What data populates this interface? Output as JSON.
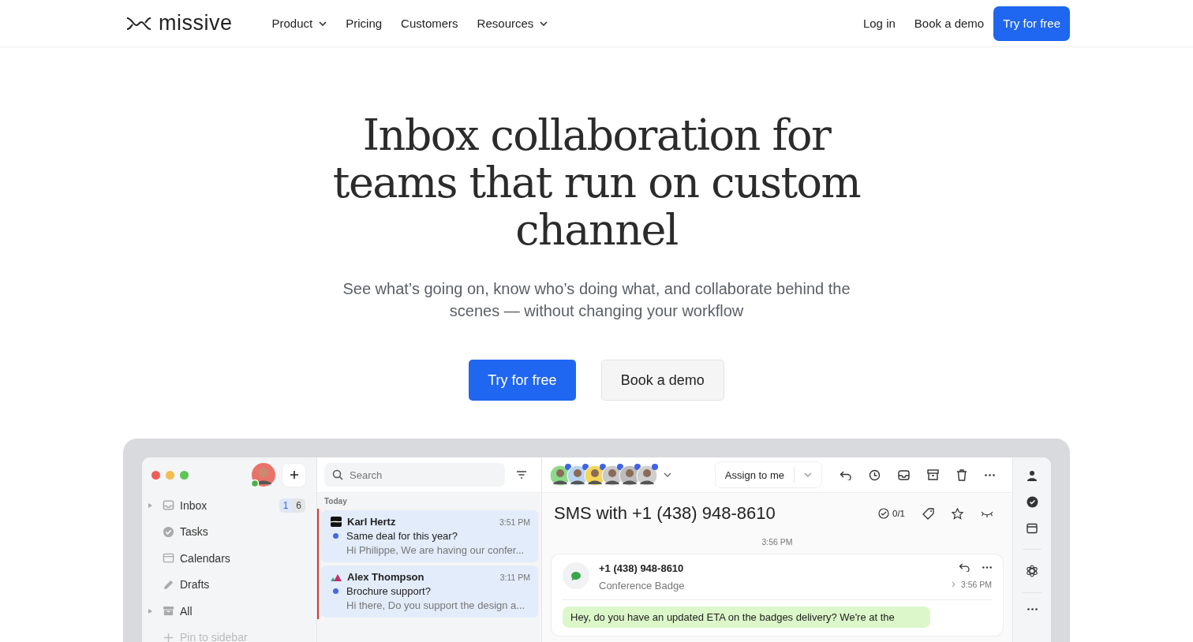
{
  "nav": {
    "brand": "missive",
    "links": [
      {
        "label": "Product",
        "dropdown": true
      },
      {
        "label": "Pricing",
        "dropdown": false
      },
      {
        "label": "Customers",
        "dropdown": false
      },
      {
        "label": "Resources",
        "dropdown": true
      }
    ],
    "login": "Log in",
    "demo": "Book a demo",
    "cta": "Try for free"
  },
  "hero": {
    "title": "Inbox collaboration for teams that run on custom channel",
    "subtitle": "See what’s going on, know who’s doing what, and collaborate behind the scenes — without changing your workflow",
    "primary": "Try for free",
    "secondary": "Book a demo"
  },
  "app": {
    "sidebar": {
      "items": [
        {
          "label": "Inbox",
          "expandable": true,
          "counts": [
            "1",
            "6"
          ]
        },
        {
          "label": "Tasks",
          "expandable": false
        },
        {
          "label": "Calendars",
          "expandable": false
        },
        {
          "label": "Drafts",
          "expandable": false
        },
        {
          "label": "All",
          "expandable": true
        },
        {
          "label": "Pin to sidebar",
          "expandable": false
        }
      ]
    },
    "list": {
      "search_placeholder": "Search",
      "section": "Today",
      "items": [
        {
          "sender": "Karl Hertz",
          "time": "3:51 PM",
          "subject": "Same deal for this year?",
          "preview": "Hi Philippe, We are having our confer...",
          "unread": true,
          "selected": true,
          "flagged": true
        },
        {
          "sender": "Alex Thompson",
          "time": "3:11 PM",
          "subject": "Brochure support?",
          "preview": "Hi there, Do you support the design a...",
          "unread": true,
          "selected": true,
          "flagged": true
        }
      ]
    },
    "conversation": {
      "participants": [
        {
          "color": "#8ed98a"
        },
        {
          "color": "#b9d4f0"
        },
        {
          "color": "#f3d65a"
        },
        {
          "color": "#c9c9c9"
        },
        {
          "color": "#bdbdbd"
        },
        {
          "color": "#cfcfcf"
        }
      ],
      "assign": "Assign to me",
      "title": "SMS with +1 (438) 948-8610",
      "tasks": "0/1",
      "timestamp": "3:56 PM",
      "message": {
        "from": "+1 (438) 948-8610",
        "subject": "Conference Badge",
        "time": "3:56 PM",
        "body": "Hey, do you have an updated ETA on the badges delivery? We're at the"
      }
    }
  }
}
